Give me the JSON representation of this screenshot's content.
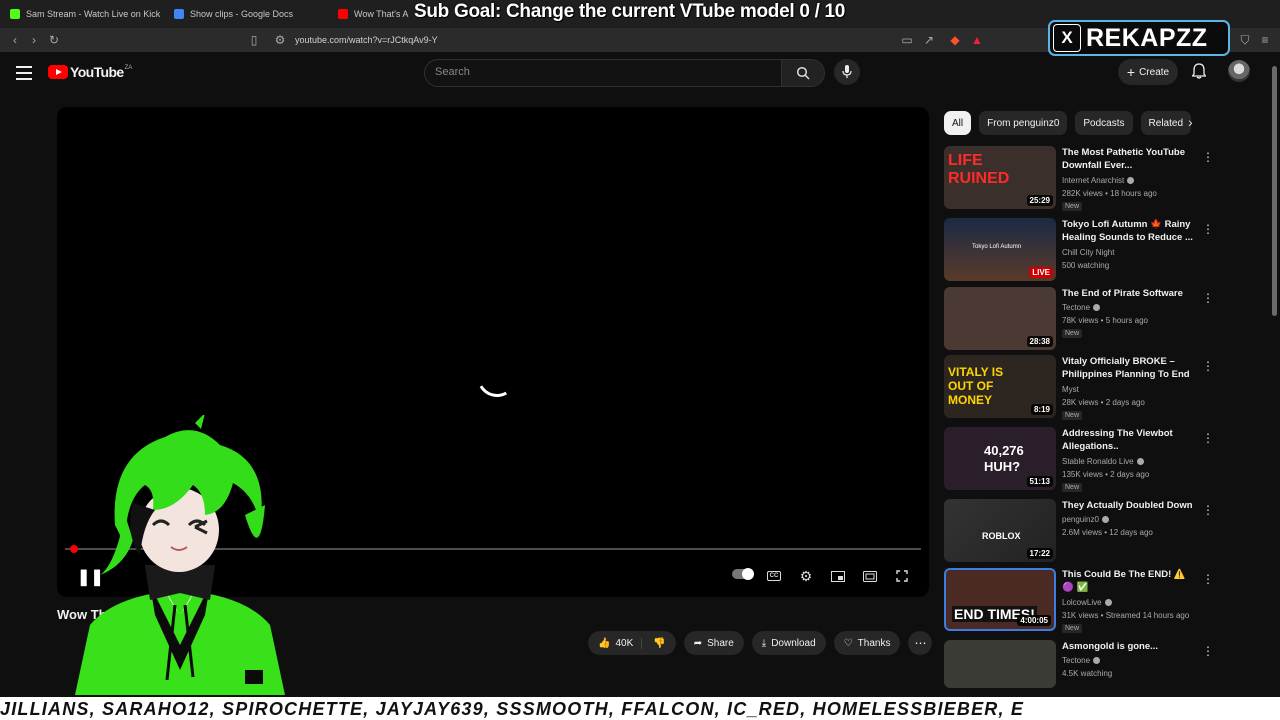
{
  "browser": {
    "tabs": [
      {
        "label": "Sam Stream - Watch Live on Kick",
        "color": "#53fc18"
      },
      {
        "label": "Show clips - Google Docs",
        "color": "#4285f4"
      },
      {
        "label": "Wow That's A Big...",
        "color": "#ff0000"
      }
    ],
    "url": "youtube.com/watch?v=rJCtkqAv9-Y"
  },
  "overlay": {
    "subgoal": "Sub Goal: Change the current VTube model  0 / 10",
    "x_handle": "REKAPZZ",
    "x_icon": "X",
    "ticker": "JILLIANS, SARAHO12, SPIROCHETTE, JAYJAY639, SSSMOOTH, FFALCON, IC_RED, HOMELESSBIEBER, E"
  },
  "youtube": {
    "logo_text": "YouTube",
    "logo_country": "ZA",
    "search_placeholder": "Search",
    "create_label": "Create",
    "video_title": "Wow Th",
    "likes": "40K",
    "share_label": "Share",
    "download_label": "Download",
    "thanks_label": "Thanks",
    "chips": [
      "All",
      "From penguinz0",
      "Podcasts",
      "Related"
    ],
    "recommendations": [
      {
        "title": "The Most Pathetic YouTube Downfall Ever...",
        "channel": "Internet Anarchist",
        "meta": "282K views • 18 hours ago",
        "badge": "New",
        "duration": "25:29",
        "thumb_text": "LIFE RUINED",
        "bg": "#3a2f2a"
      },
      {
        "title": "Tokyo Lofi Autumn 🍁 Rainy Healing Sounds to Reduce ...",
        "channel": "Chill City Night",
        "meta": "500 watching",
        "badge": "",
        "duration": "LIVE",
        "thumb_text": "Tokyo Lofi Autumn",
        "bg": "#24324a"
      },
      {
        "title": "The End of Pirate Software",
        "channel": "Tectone",
        "meta": "78K views • 5 hours ago",
        "badge": "New",
        "duration": "28:38",
        "thumb_text": "",
        "bg": "#4a3a33"
      },
      {
        "title": "Vitaly Officially BROKE – Philippines Planning To End ...",
        "channel": "Myst",
        "meta": "28K views • 2 days ago",
        "badge": "New",
        "duration": "8:19",
        "thumb_text": "VITALY IS OUT OF MONEY",
        "bg": "#2d2620"
      },
      {
        "title": "Addressing The Viewbot Allegations..",
        "channel": "Stable Ronaldo Live",
        "meta": "135K views • 2 days ago",
        "badge": "New",
        "duration": "51:13",
        "thumb_text": "40,276 HUH?",
        "bg": "#2a1e2a"
      },
      {
        "title": "They Actually Doubled Down",
        "channel": "penguinz0",
        "meta": "2.6M views • 12 days ago",
        "badge": "",
        "duration": "17:22",
        "thumb_text": "ROBLOX",
        "bg": "#2a2a2a"
      },
      {
        "title": "This Could Be The END! ⚠️ 🟣 ✅",
        "channel": "LolcowLive",
        "meta": "31K views • Streamed 14 hours ago",
        "badge": "New",
        "duration": "4:00:05",
        "thumb_text": "END TIMES!",
        "bg": "#4a2a22"
      },
      {
        "title": "Asmongold is gone...",
        "channel": "Tectone",
        "meta": "4.5K watching",
        "badge": "",
        "duration": "",
        "thumb_text": "",
        "bg": "#3b3b35"
      }
    ]
  },
  "colors": {
    "accent_red": "#ff0000",
    "bg": "#0f0f0f",
    "chip_bg": "#272727",
    "vtuber_green": "#39e11a",
    "badge_border": "#5bb6e8"
  }
}
